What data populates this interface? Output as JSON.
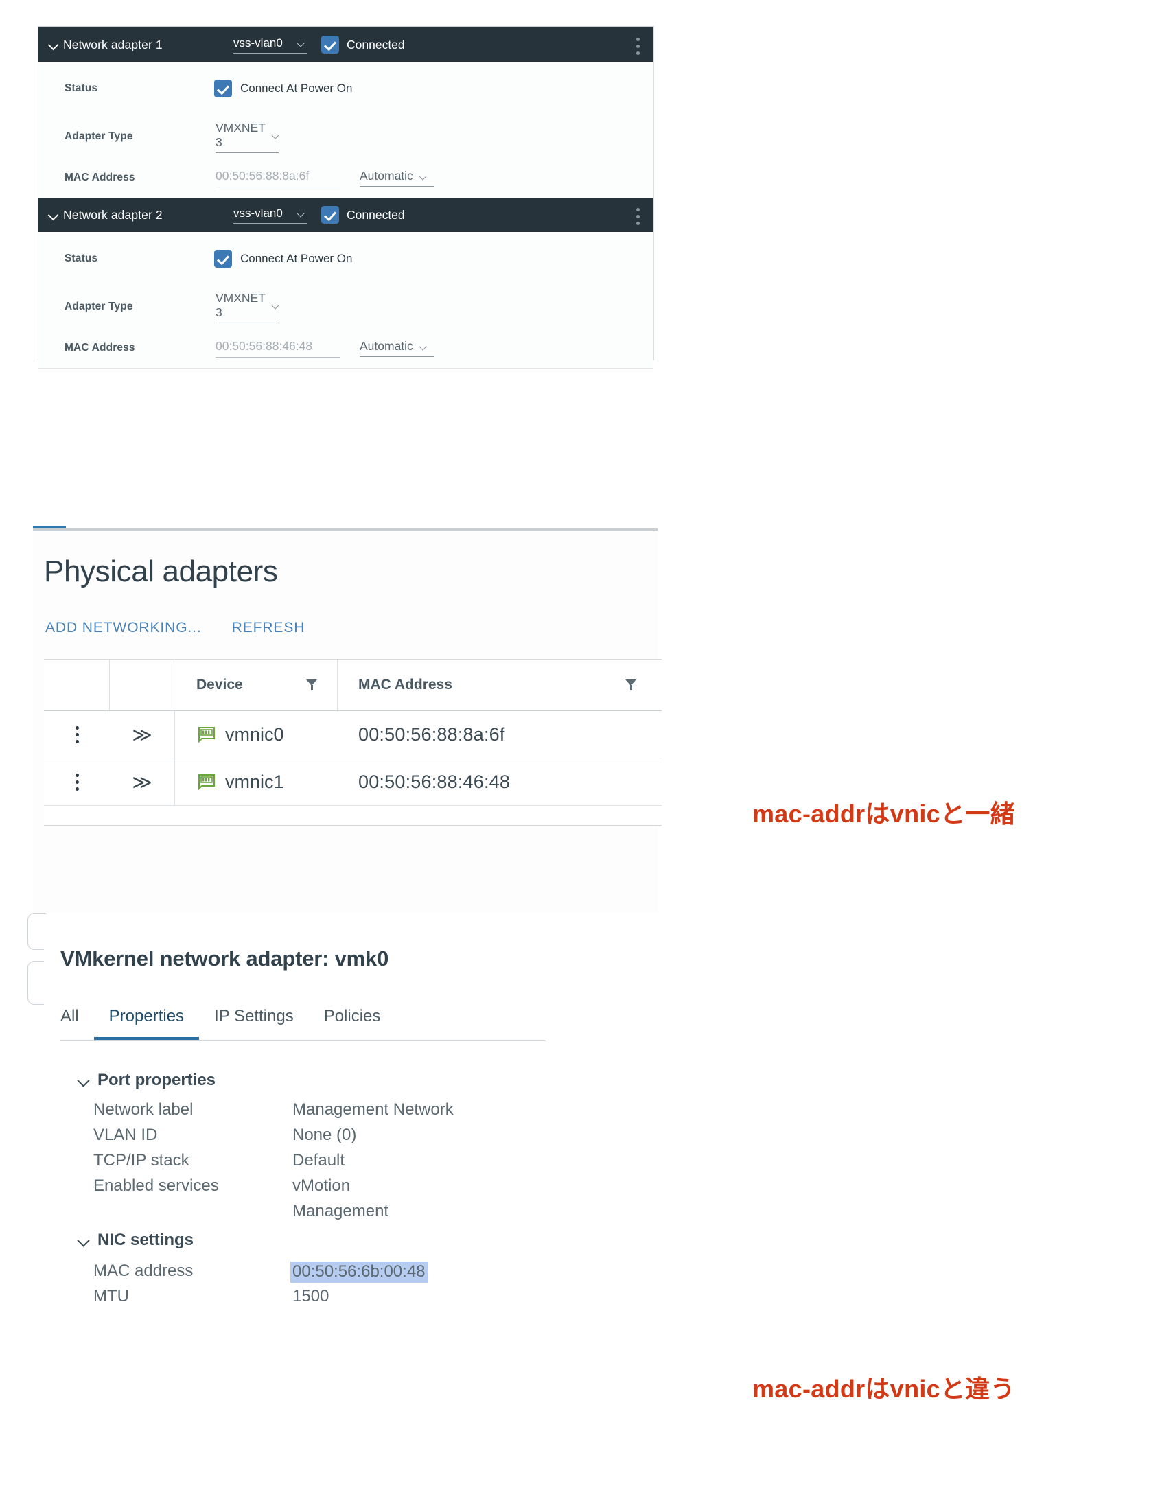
{
  "vm_hardware": {
    "adapters": [
      {
        "title": "Network adapter 1",
        "network": "vss-vlan0",
        "connected_label": "Connected",
        "rows": {
          "status_label": "Status",
          "status_value": "Connect At Power On",
          "adapter_type_label": "Adapter Type",
          "adapter_type_value": "VMXNET 3",
          "mac_label": "MAC Address",
          "mac_value": "00:50:56:88:8a:6f",
          "mac_mode": "Automatic"
        }
      },
      {
        "title": "Network adapter 2",
        "network": "vss-vlan0",
        "connected_label": "Connected",
        "rows": {
          "status_label": "Status",
          "status_value": "Connect At Power On",
          "adapter_type_label": "Adapter Type",
          "adapter_type_value": "VMXNET 3",
          "mac_label": "MAC Address",
          "mac_value": "00:50:56:88:46:48",
          "mac_mode": "Automatic"
        }
      }
    ]
  },
  "physical_adapters": {
    "title": "Physical adapters",
    "actions": {
      "add_networking": "ADD NETWORKING...",
      "refresh": "REFRESH"
    },
    "table": {
      "headers": {
        "device": "Device",
        "mac_address": "MAC Address"
      },
      "rows": [
        {
          "expand": "≫",
          "device": "vmnic0",
          "mac": "00:50:56:88:8a:6f"
        },
        {
          "expand": "≫",
          "device": "vmnic1",
          "mac": "00:50:56:88:46:48"
        }
      ]
    }
  },
  "vmkernel": {
    "title": "VMkernel network adapter: vmk0",
    "tabs": [
      {
        "label": "All",
        "active": false
      },
      {
        "label": "Properties",
        "active": true
      },
      {
        "label": "IP Settings",
        "active": false
      },
      {
        "label": "Policies",
        "active": false
      }
    ],
    "port_properties": {
      "group_title": "Port properties",
      "network_label_key": "Network label",
      "network_label_value": "Management Network",
      "vlan_id_key": "VLAN ID",
      "vlan_id_value": "None (0)",
      "tcpip_key": "TCP/IP stack",
      "tcpip_value": "Default",
      "services_key": "Enabled services",
      "services_value_1": "vMotion",
      "services_value_2": "Management"
    },
    "nic_settings": {
      "group_title": "NIC settings",
      "mac_key": "MAC address",
      "mac_value": "00:50:56:6b:00:48",
      "mtu_key": "MTU",
      "mtu_value": "1500"
    }
  },
  "annotations": {
    "same_as_vnic": "mac-addrはvnicと一緒",
    "differs_from_vnic": "mac-addrはvnicと違う"
  },
  "colors": {
    "header_bg": "#27333b",
    "checkbox_blue": "#3d7ab5",
    "link_blue": "#4a81b4",
    "annotation_red": "#d43915",
    "highlight_blue": "#b6ccf0",
    "nic_icon_green": "#6aa83c"
  }
}
